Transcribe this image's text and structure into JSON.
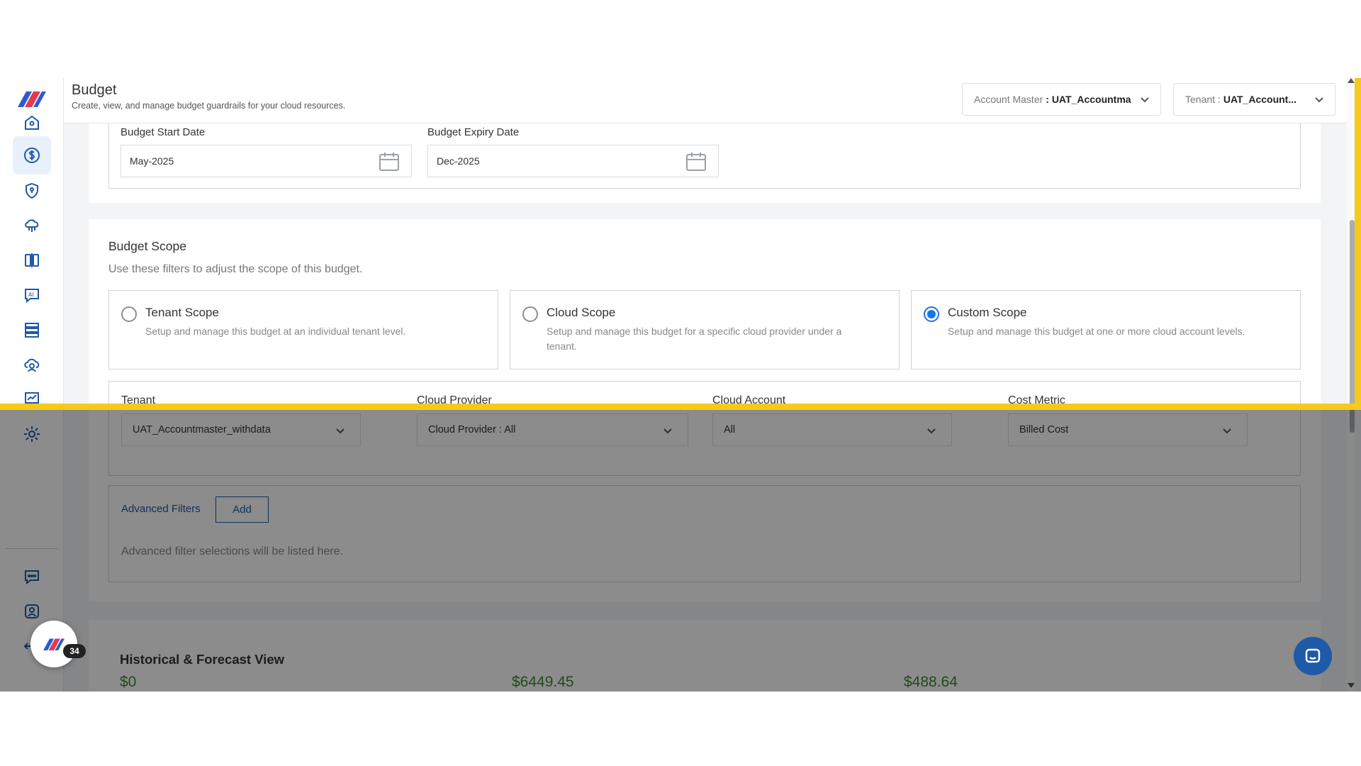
{
  "header": {
    "title": "Budget",
    "subtitle": "Create, view, and manage budget guardrails for your cloud resources.",
    "account_master_label": "Account Master",
    "account_master_value": ": UAT_Accountma",
    "tenant_label": "Tenant :",
    "tenant_value": "UAT_Account..."
  },
  "dates": {
    "start_label": "Budget Start Date",
    "start_value": "May-2025",
    "expiry_label": "Budget Expiry Date",
    "expiry_value": "Dec-2025"
  },
  "scope": {
    "title": "Budget Scope",
    "description": "Use these filters to adjust the scope of this budget.",
    "options": [
      {
        "label": "Tenant Scope",
        "desc": "Setup and manage this budget at an individual tenant level.",
        "checked": false
      },
      {
        "label": "Cloud Scope",
        "desc": "Setup and manage this budget for a specific cloud provider under a tenant.",
        "checked": false
      },
      {
        "label": "Custom Scope",
        "desc": "Setup and manage this budget at one or more cloud account levels.",
        "checked": true
      }
    ]
  },
  "filters": {
    "tenant_label": "Tenant",
    "tenant_value": "UAT_Accountmaster_withdata",
    "provider_label": "Cloud Provider",
    "provider_value": "Cloud Provider : All",
    "account_label": "Cloud Account",
    "account_value": "All",
    "metric_label": "Cost Metric",
    "metric_value": "Billed Cost"
  },
  "advanced": {
    "label": "Advanced Filters",
    "add_label": "Add",
    "empty_text": "Advanced filter selections will be listed here."
  },
  "history": {
    "title": "Historical & Forecast View",
    "values": [
      "$0",
      "$6449.45",
      "$488.64"
    ]
  },
  "badge_count": "34",
  "colors": {
    "accent": "#1e5aa8",
    "highlight": "#f6c91b",
    "radio_selected": "#1a73e8",
    "money_green": "#3d8a2e"
  },
  "nav_icons": [
    "home-icon",
    "dollar-icon",
    "shield-icon",
    "cloud-network-icon",
    "split-view-icon",
    "ai-chat-icon",
    "server-icon",
    "cloud-user-icon",
    "presentation-chart-icon",
    "gear-icon",
    "chat-bubble-icon",
    "user-support-icon",
    "logout-icon"
  ]
}
